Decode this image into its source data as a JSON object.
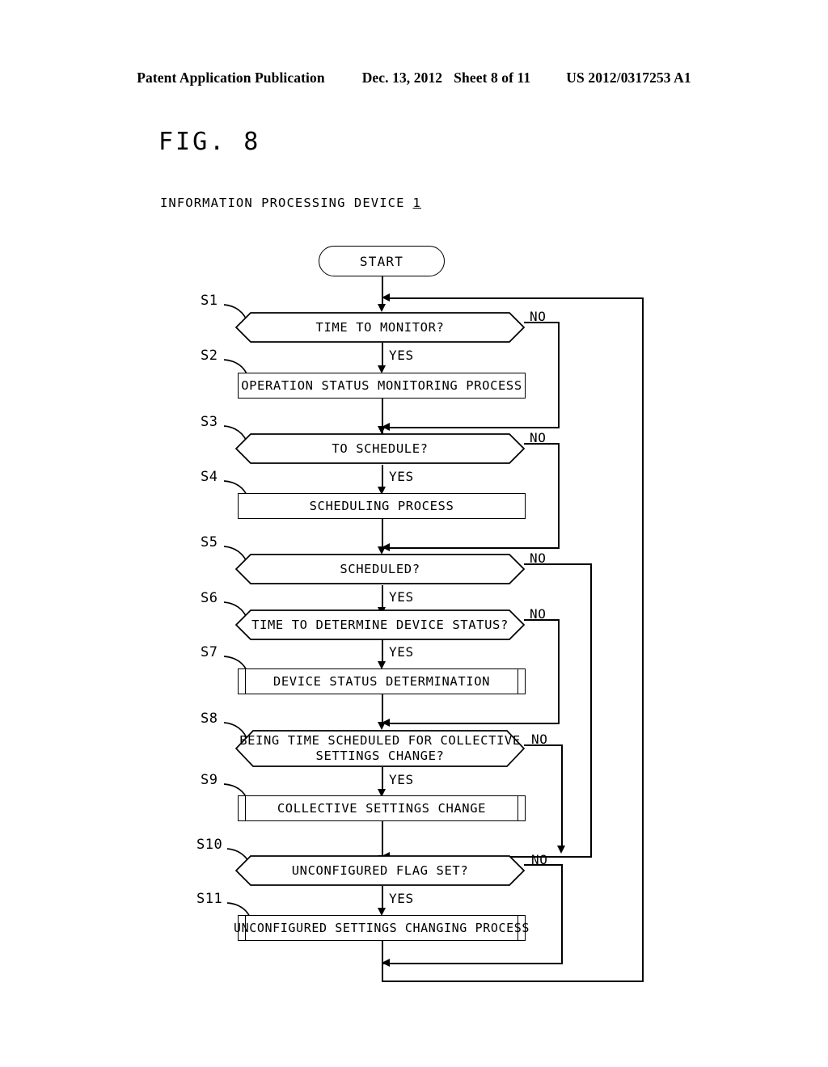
{
  "header": {
    "publication": "Patent Application Publication",
    "date": "Dec. 13, 2012",
    "sheet": "Sheet 8 of 11",
    "patent_number": "US 2012/0317253 A1"
  },
  "figure": {
    "title": "FIG. 8",
    "subtitle": "INFORMATION PROCESSING DEVICE",
    "subtitle_ref": "1"
  },
  "flowchart": {
    "start_label": "START",
    "yes_label": "YES",
    "no_label": "NO",
    "steps": [
      {
        "id": "S1",
        "type": "decision",
        "text": "TIME TO MONITOR?"
      },
      {
        "id": "S2",
        "type": "process",
        "text": "OPERATION STATUS MONITORING PROCESS"
      },
      {
        "id": "S3",
        "type": "decision",
        "text": "TO SCHEDULE?"
      },
      {
        "id": "S4",
        "type": "process",
        "text": "SCHEDULING PROCESS"
      },
      {
        "id": "S5",
        "type": "decision",
        "text": "SCHEDULED?"
      },
      {
        "id": "S6",
        "type": "decision",
        "text": "TIME TO DETERMINE DEVICE STATUS?"
      },
      {
        "id": "S7",
        "type": "predefined-process",
        "text": "DEVICE STATUS DETERMINATION"
      },
      {
        "id": "S8",
        "type": "decision",
        "text": "BEING TIME SCHEDULED FOR COLLECTIVE\nSETTINGS CHANGE?"
      },
      {
        "id": "S9",
        "type": "predefined-process",
        "text": "COLLECTIVE SETTINGS CHANGE"
      },
      {
        "id": "S10",
        "type": "decision",
        "text": "UNCONFIGURED FLAG SET?"
      },
      {
        "id": "S11",
        "type": "predefined-process",
        "text": "UNCONFIGURED SETTINGS CHANGING PROCESS"
      }
    ],
    "branches": {
      "s1_no": "NO",
      "s1_yes": "YES",
      "s3_no": "NO",
      "s3_yes": "YES",
      "s5_no": "NO",
      "s5_yes": "YES",
      "s6_no": "NO",
      "s6_yes": "YES",
      "s8_no": "NO",
      "s8_yes": "YES",
      "s10_no": "NO",
      "s10_yes": "YES"
    }
  },
  "colors": {
    "ink": "#000000",
    "paper": "#ffffff"
  }
}
